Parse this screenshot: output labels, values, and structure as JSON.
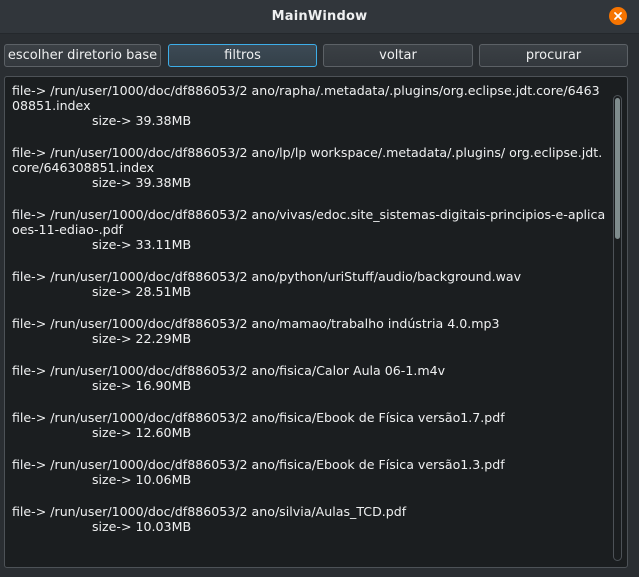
{
  "window": {
    "title": "MainWindow"
  },
  "toolbar": {
    "choose_base_dir_label": "escolher diretorio base",
    "filters_label": "filtros",
    "back_label": "voltar",
    "search_label": "procurar"
  },
  "results": [
    {
      "path": "file-> /run/user/1000/doc/df886053/2 ano/rapha/.metadata/.plugins/org.eclipse.jdt.core/646308851.index",
      "size": "size-> 39.38MB"
    },
    {
      "path": "file-> /run/user/1000/doc/df886053/2 ano/lp/lp workspace/.metadata/.plugins/ org.eclipse.jdt.core/646308851.index",
      "size": "size-> 39.38MB"
    },
    {
      "path": "file-> /run/user/1000/doc/df886053/2 ano/vivas/edoc.site_sistemas-digitais-principios-e-aplicaoes-11-ediao-.pdf",
      "size": "size-> 33.11MB"
    },
    {
      "path": "file-> /run/user/1000/doc/df886053/2 ano/python/uriStuff/audio/background.wav",
      "size": "size-> 28.51MB"
    },
    {
      "path": "file-> /run/user/1000/doc/df886053/2 ano/mamao/trabalho indústria 4.0.mp3",
      "size": "size-> 22.29MB"
    },
    {
      "path": "file-> /run/user/1000/doc/df886053/2 ano/fisica/Calor Aula 06-1.m4v",
      "size": "size-> 16.90MB"
    },
    {
      "path": "file-> /run/user/1000/doc/df886053/2 ano/fisica/Ebook de Física versão1.7.pdf",
      "size": "size-> 12.60MB"
    },
    {
      "path": "file-> /run/user/1000/doc/df886053/2 ano/fisica/Ebook de Física versão1.3.pdf",
      "size": "size-> 10.06MB"
    },
    {
      "path": "file-> /run/user/1000/doc/df886053/2 ano/silvia/Aulas_TCD.pdf",
      "size": "size-> 10.03MB"
    }
  ],
  "scrollbar": {
    "position_fraction": 0.0,
    "visible_fraction": 0.3
  },
  "colors": {
    "accent": "#3daee9",
    "close_button": "#f67400",
    "list_background": "#1b1e20",
    "window_background": "#2a2e32"
  },
  "icons": {
    "close": "close-icon"
  }
}
